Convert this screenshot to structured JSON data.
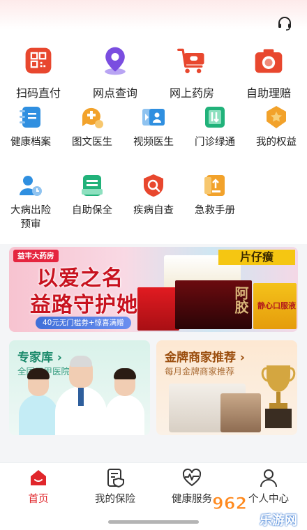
{
  "header": {
    "support_icon": "headset-icon"
  },
  "main_services": [
    {
      "label": "扫码直付",
      "icon": "qr-scan-icon",
      "color": "#e8472e"
    },
    {
      "label": "网点查询",
      "icon": "location-pin-icon",
      "color": "#7a4de0"
    },
    {
      "label": "网上药房",
      "icon": "shopping-cart-icon",
      "color": "#e8472e"
    },
    {
      "label": "自助理赔",
      "icon": "camera-icon",
      "color": "#e8472e"
    }
  ],
  "sub_services": [
    {
      "label": "健康档案",
      "icon": "health-record-icon",
      "color": "#2f8fe0"
    },
    {
      "label": "图文医生",
      "icon": "chat-doctor-icon",
      "color": "#f2a22b"
    },
    {
      "label": "视频医生",
      "icon": "video-doctor-icon",
      "color": "#2f8fe0"
    },
    {
      "label": "门诊绿通",
      "icon": "clinic-green-icon",
      "color": "#21b27a"
    },
    {
      "label": "我的权益",
      "icon": "rights-badge-icon",
      "color": "#f2a22b"
    }
  ],
  "sub_services_2": [
    {
      "label": "大病出险",
      "label2": "预审",
      "icon": "illness-review-icon",
      "color": "#2f8fe0"
    },
    {
      "label": "自助保全",
      "label2": "",
      "icon": "policy-service-icon",
      "color": "#21b27a"
    },
    {
      "label": "疾病自查",
      "label2": "",
      "icon": "self-check-icon",
      "color": "#e8472e"
    },
    {
      "label": "急救手册",
      "label2": "",
      "icon": "first-aid-manual-icon",
      "color": "#f2a22b"
    }
  ],
  "banner": {
    "brand": "益丰大药房",
    "line1": "以爱之名",
    "line2": "益路守护她",
    "promo": "40元无门槛券+惊喜满赠",
    "product_a": "片仔癀",
    "product_b": "阿胶",
    "product_c": "静心口服液"
  },
  "cards": {
    "expert": {
      "title": "专家库",
      "arrow": "›",
      "subtitle": "全国三甲医院专家"
    },
    "merchant": {
      "title": "金牌商家推荐",
      "arrow": "›",
      "subtitle": "每月金牌商家推荐"
    }
  },
  "tabs": [
    {
      "label": "首页",
      "icon": "home-icon",
      "active": true
    },
    {
      "label": "我的保险",
      "icon": "insurance-doc-icon",
      "active": false
    },
    {
      "label": "健康服务",
      "icon": "health-heart-icon",
      "active": false
    },
    {
      "label": "个人中心",
      "icon": "person-icon",
      "active": false
    }
  ],
  "watermark": {
    "text": "乐游网",
    "number": "962"
  },
  "colors": {
    "accent": "#e0262b",
    "expert_green": "#1a8a6b",
    "merchant_brown": "#9b4e0e"
  }
}
